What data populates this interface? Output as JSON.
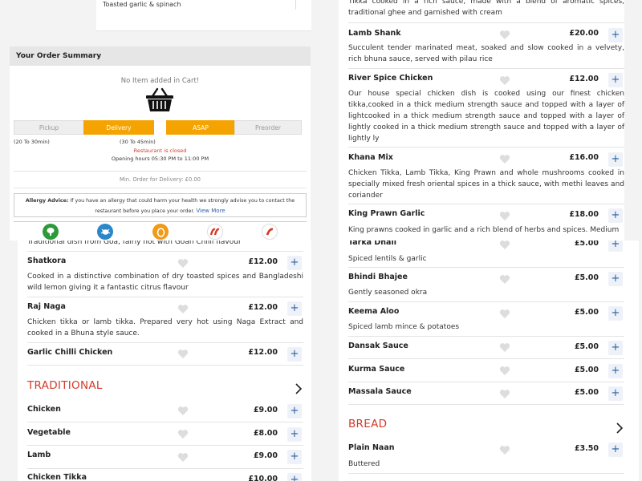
{
  "q1": {
    "top_item_desc": "Toasted garlic & spinach",
    "summary_title": "Your Order Summary",
    "no_item": "No Item added in Cart!",
    "seg_pickup": "Pickup",
    "seg_delivery": "Delivery",
    "seg_asap": "ASAP",
    "seg_preorder": "Preorder",
    "pickup_time": "(20 To 30min)",
    "delivery_time": "(30 To 45min)",
    "closed": "Restaurant is closed",
    "hours": "Opening hours 05:30 PM to 11:00 PM",
    "min_order": "Min. Order for Delivery: £0.00",
    "allergy_label": "Allergy Advice:",
    "allergy_text": " If you have an allergy that could harm your health we strongly advise you to contact the",
    "allergy_text2": "restaurant before you place your order.",
    "view_more": "View More",
    "diet_icons": [
      "vegetarian-icon",
      "seafood-icon",
      "egg-icon",
      "spicy-icon",
      "hot-chilli-icon"
    ]
  },
  "q2": {
    "top_desc": "Tikka cooked in a rich sauce, made with a blend of aromatic spices, traditional ghee and garnished with cream",
    "items": [
      {
        "name": "Lamb Shank",
        "price": "£20.00",
        "desc": "Succulent tender marinated meat, soaked and slow cooked in a velvety, rich bhuna sauce, served with pilau rice"
      },
      {
        "name": "River Spice Chicken",
        "price": "£12.00",
        "desc": "Our house special chicken dish is cooked using our finest chicken tikka,cooked in a thick medium strength sauce and topped with a layer of lightcooked in a thick medium strength sauce and topped with a layer of lightly cooked in a thick medium strength sauce and topped with a layer of lightly ly"
      },
      {
        "name": "Khana Mix",
        "price": "£16.00",
        "desc": "Chicken Tikka, Lamb Tikka, King Prawn and whole mushrooms cooked in specially mixed fresh oriental spices in a thick sauce, with methi leaves and coriander"
      },
      {
        "name": "King Prawn Garlic",
        "price": "£18.00",
        "desc": "King prawns cooked in garlic and a rich blend of herbs and spices. Medium"
      }
    ]
  },
  "q3": {
    "top_desc": "Traditional dish from Goa, fairly hot with Goan Chilli flavour",
    "items": [
      {
        "name": "Shatkora",
        "price": "£12.00",
        "desc": "Cooked in a distinctive combination of dry toasted spices and Bangladeshi wild lemon giving it a fantastic citrus flavour"
      },
      {
        "name": "Raj Naga",
        "price": "£12.00",
        "desc": "Chicken tikka or lamb tikka. Prepared very hot using Naga Extract and cooked in a Bhuna style sauce."
      },
      {
        "name": "Garlic Chilli Chicken",
        "price": "£12.00"
      }
    ],
    "category": "TRADITIONAL",
    "trad_items": [
      {
        "name": "Chicken",
        "price": "£9.00"
      },
      {
        "name": "Vegetable",
        "price": "£8.00"
      },
      {
        "name": "Lamb",
        "price": "£9.00"
      },
      {
        "name": "Chicken Tikka",
        "price": "£10.00"
      }
    ]
  },
  "q4": {
    "items": [
      {
        "name": "Tarka Dhall",
        "price": "£5.00",
        "desc": "Spiced lentils & garlic"
      },
      {
        "name": "Bhindi Bhajee",
        "price": "£5.00",
        "desc": "Gently seasoned okra"
      },
      {
        "name": "Keema Aloo",
        "price": "£5.00",
        "desc": "Spiced lamb mince & potatoes"
      },
      {
        "name": "Dansak Sauce",
        "price": "£5.00"
      },
      {
        "name": "Kurma Sauce",
        "price": "£5.00"
      },
      {
        "name": "Massala Sauce",
        "price": "£5.00"
      }
    ],
    "category": "BREAD",
    "bread_items": [
      {
        "name": "Plain Naan",
        "price": "£3.50",
        "desc": "Buttered"
      }
    ]
  },
  "colors": {
    "accent": "#f5a300",
    "brand_red": "#d23b2a",
    "link": "#2b5fa8"
  }
}
